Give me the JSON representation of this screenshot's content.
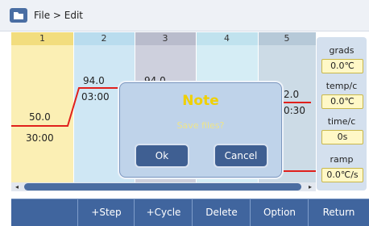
{
  "header": {
    "title": "File > Edit",
    "icon": "folder-icon"
  },
  "steps": {
    "headers": [
      "1",
      "2",
      "3",
      "4",
      "5"
    ],
    "step1": {
      "temp": "50.0",
      "time": "30:00"
    },
    "step2": {
      "temp": "94.0",
      "time": "03:00"
    },
    "step3": {
      "temp": "94.0"
    },
    "step5": {
      "temp": "2.0",
      "time": "0:30"
    }
  },
  "side_panel": {
    "grads_label": "grads",
    "grads_value": "0.0℃",
    "temp_label": "temp/c",
    "temp_value": "0.0℃",
    "time_label": "time/c",
    "time_value": "0s",
    "ramp_label": "ramp",
    "ramp_value": "0.0℃/s"
  },
  "scrollbar": {
    "left_arrow": "◂",
    "right_arrow": "▸"
  },
  "toolbar": {
    "step": "+Step",
    "cycle": "+Cycle",
    "delete": "Delete",
    "option": "Option",
    "return": "Return"
  },
  "dialog": {
    "title": "Note",
    "message": "Save files?",
    "ok": "Ok",
    "cancel": "Cancel"
  },
  "colors": {
    "accent": "#40659e",
    "trace": "#e0201c",
    "dialog_title": "#f0d000"
  }
}
